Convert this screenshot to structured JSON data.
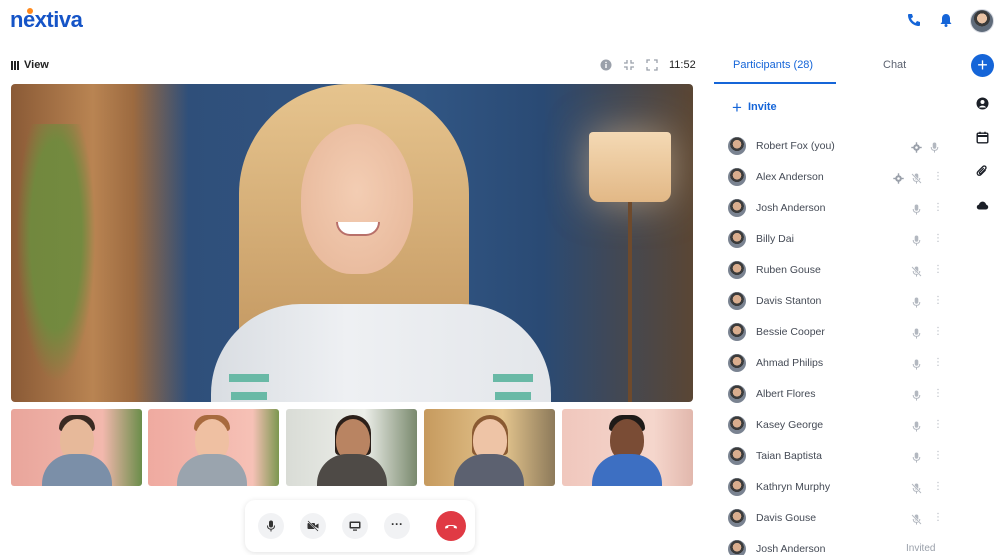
{
  "brand": {
    "logo_text": "nextiva",
    "accent": "#1565d8",
    "logo_dot": "#ff8a1d"
  },
  "header": {
    "icons": [
      "phone-icon",
      "bell-icon"
    ],
    "user_avatar": "user-avatar"
  },
  "meeting": {
    "view_label": "View",
    "clock": "11:52",
    "toolbar_icons": [
      "info-icon",
      "collapse-icon",
      "fullscreen-icon"
    ]
  },
  "controls": {
    "buttons": [
      "microphone",
      "camera-off",
      "share-screen",
      "more",
      "hang-up"
    ],
    "more_label": "···",
    "hangup_color": "#e03a44"
  },
  "panel": {
    "tabs": [
      {
        "label": "Participants (28)",
        "active": true
      },
      {
        "label": "Chat",
        "active": false
      }
    ],
    "invite_label": "Invite",
    "participants": [
      {
        "name": "Robert Fox (you)",
        "gear": true,
        "mic_muted": false,
        "more": false,
        "status": ""
      },
      {
        "name": "Alex Anderson",
        "gear": true,
        "mic_muted": true,
        "more": true,
        "status": ""
      },
      {
        "name": "Josh Anderson",
        "gear": false,
        "mic_muted": false,
        "more": true,
        "status": ""
      },
      {
        "name": "Billy Dai",
        "gear": false,
        "mic_muted": false,
        "more": true,
        "status": ""
      },
      {
        "name": "Ruben Gouse",
        "gear": false,
        "mic_muted": true,
        "more": true,
        "status": ""
      },
      {
        "name": "Davis Stanton",
        "gear": false,
        "mic_muted": false,
        "more": true,
        "status": ""
      },
      {
        "name": "Bessie Cooper",
        "gear": false,
        "mic_muted": false,
        "more": true,
        "status": ""
      },
      {
        "name": "Ahmad Philips",
        "gear": false,
        "mic_muted": false,
        "more": true,
        "status": ""
      },
      {
        "name": "Albert Flores",
        "gear": false,
        "mic_muted": false,
        "more": true,
        "status": ""
      },
      {
        "name": "Kasey George",
        "gear": false,
        "mic_muted": false,
        "more": true,
        "status": ""
      },
      {
        "name": "Taian Baptista",
        "gear": false,
        "mic_muted": false,
        "more": true,
        "status": ""
      },
      {
        "name": "Kathryn Murphy",
        "gear": false,
        "mic_muted": true,
        "more": true,
        "status": ""
      },
      {
        "name": "Davis Gouse",
        "gear": false,
        "mic_muted": true,
        "more": true,
        "status": ""
      },
      {
        "name": "Josh Anderson",
        "gear": false,
        "mic_muted": false,
        "more": false,
        "status": "Invited"
      }
    ]
  },
  "rail": {
    "add_label": "+",
    "icons": [
      "contact-icon",
      "calendar-icon",
      "attachment-icon",
      "cloud-icon"
    ]
  }
}
